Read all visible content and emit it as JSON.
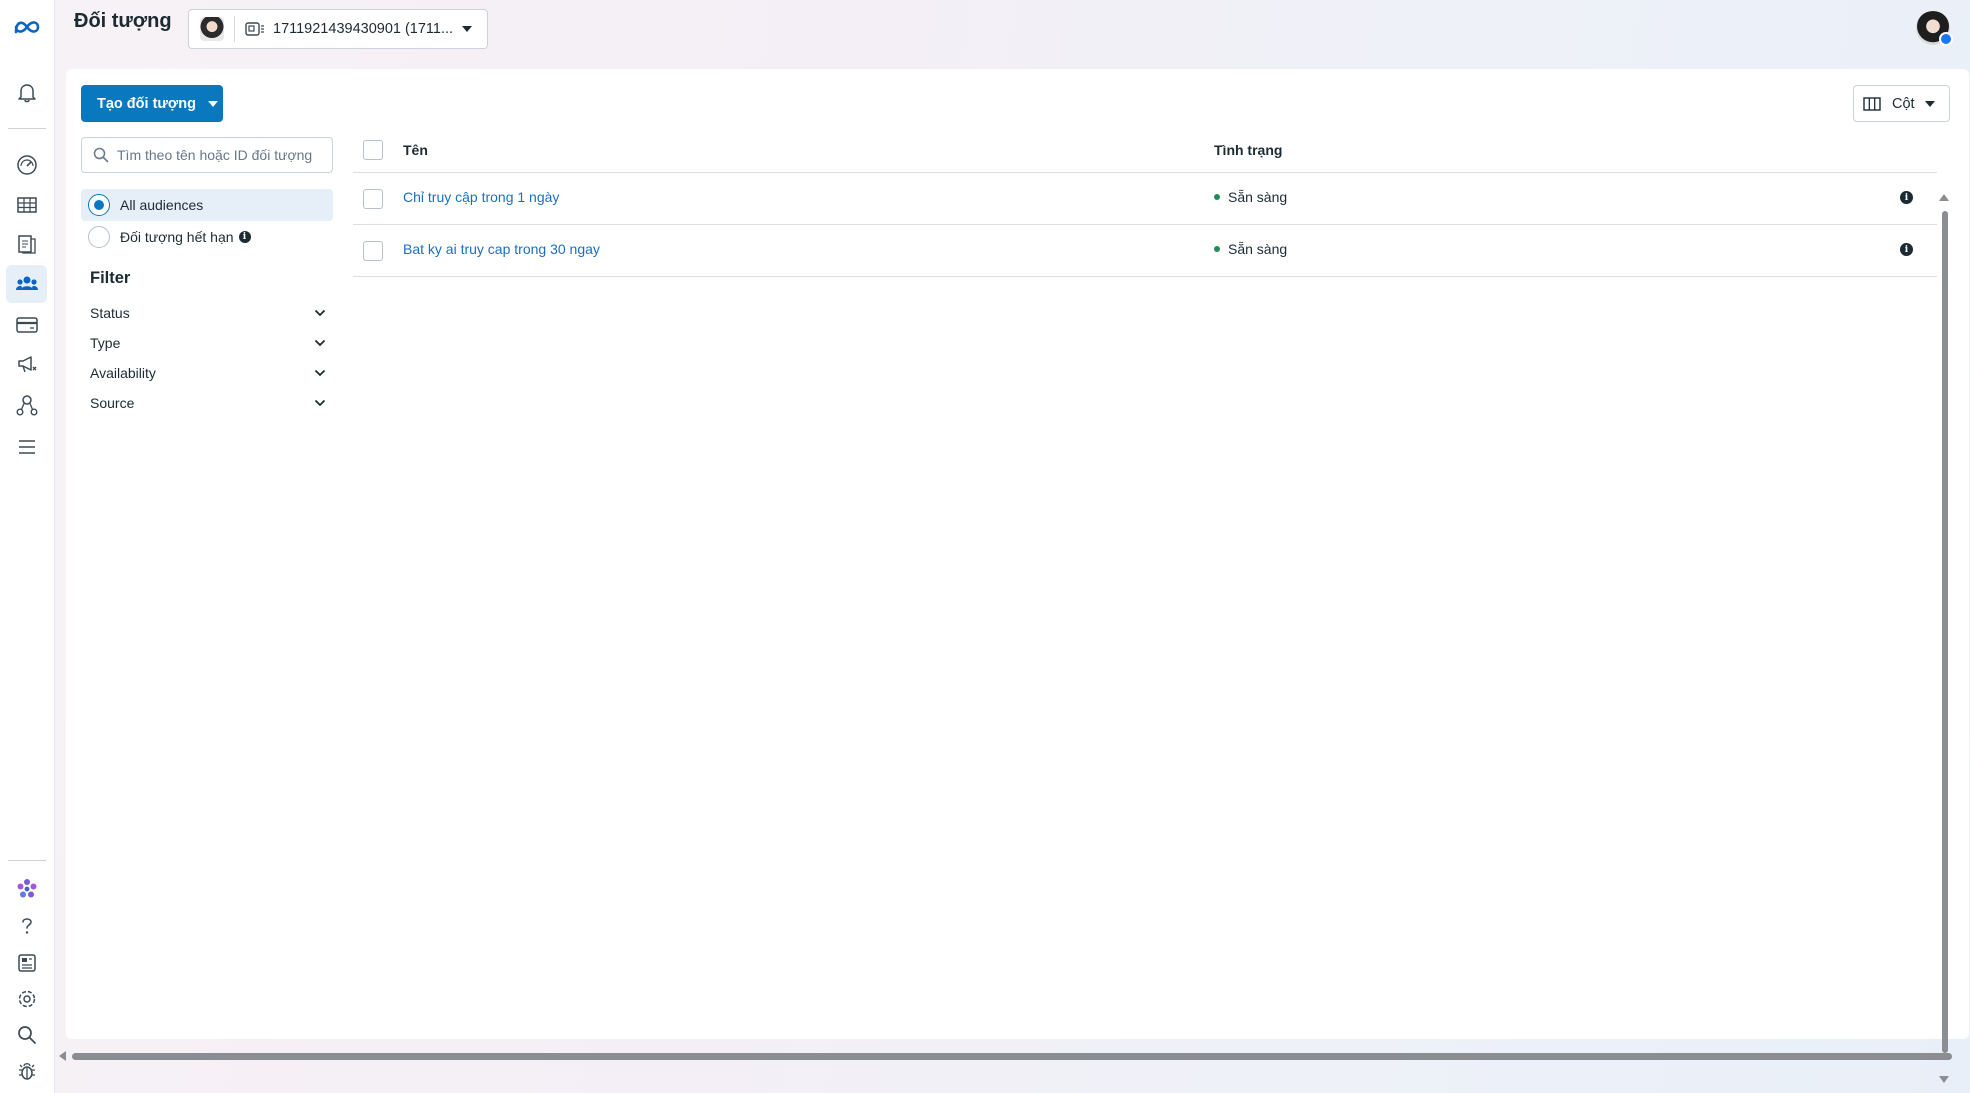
{
  "app": {
    "page_title": "Đối tượng",
    "account_id": "1711921439430901 (1711..."
  },
  "nav": {
    "items": [
      {
        "icon": "meta-logo-icon"
      },
      {
        "icon": "bell-icon"
      },
      {
        "icon": "dashboard-icon"
      },
      {
        "icon": "table-icon"
      },
      {
        "icon": "pages-icon"
      },
      {
        "icon": "audiences-icon",
        "active": true
      },
      {
        "icon": "billing-card-icon"
      },
      {
        "icon": "megaphone-icon"
      },
      {
        "icon": "hierarchy-icon"
      },
      {
        "icon": "menu-icon"
      },
      {
        "icon": "flower-icon"
      },
      {
        "icon": "help-icon"
      },
      {
        "icon": "news-icon"
      },
      {
        "icon": "settings-gear-icon"
      },
      {
        "icon": "search-icon"
      },
      {
        "icon": "bug-icon"
      }
    ]
  },
  "toolbar": {
    "create_label": "Tạo đối tượng",
    "columns_label": "Cột"
  },
  "sidebar": {
    "search_placeholder": "Tìm theo tên hoặc ID đối tượng",
    "views": [
      {
        "label": "All audiences",
        "selected": true
      },
      {
        "label": "Đối tượng hết hạn",
        "selected": false
      }
    ],
    "filter_title": "Filter",
    "filters": [
      "Status",
      "Type",
      "Availability",
      "Source"
    ]
  },
  "table": {
    "columns": [
      "Tên",
      "Tình trạng"
    ],
    "rows": [
      {
        "name": "Chỉ truy cập trong 1 ngày",
        "status": "Sẵn sàng"
      },
      {
        "name": "Bat ky ai truy cap trong 30 ngay",
        "status": "Sẵn sàng"
      }
    ]
  },
  "colors": {
    "accent": "#0a78be",
    "link": "#1a6fc2",
    "status_ready": "#1e8d57"
  }
}
